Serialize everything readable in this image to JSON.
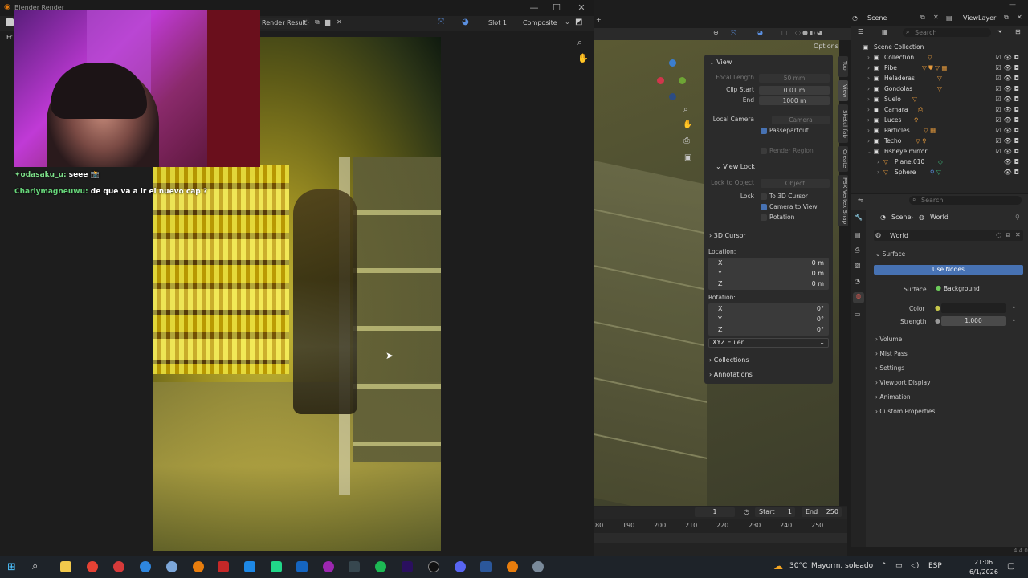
{
  "render_window": {
    "title": "Blender Render",
    "image_name": "Render Result",
    "slot": "Slot 1",
    "pass": "Composite",
    "menu_clip": "Fr"
  },
  "chat": [
    {
      "user": "odasaku_u:",
      "message": "seee 📸"
    },
    {
      "user": "Charlymagneuwu:",
      "message": "de que va a ir el nuevo cap ?"
    }
  ],
  "viewport": {
    "options_label": "Options"
  },
  "npanel": {
    "view_header": "View",
    "focal_length_label": "Focal Length",
    "focal_length_value": "50 mm",
    "clip_start_label": "Clip Start",
    "clip_start_value": "0.01 m",
    "end_label": "End",
    "end_value": "1000 m",
    "local_camera_label": "Local Camera",
    "local_camera_value": "Camera",
    "passepartout_label": "Passepartout",
    "render_region_label": "Render Region",
    "view_lock_header": "View Lock",
    "lock_to_object_label": "Lock to Object",
    "lock_to_object_value": "Object",
    "lock_label": "Lock",
    "to_3d_cursor_label": "To 3D Cursor",
    "camera_to_view_label": "Camera to View",
    "rotation_label": "Rotation",
    "cursor_header": "3D Cursor",
    "location_label": "Location:",
    "x_label": "X",
    "y_label": "Y",
    "z_label": "Z",
    "loc_x": "0 m",
    "loc_y": "0 m",
    "loc_z": "0 m",
    "rotation_section_label": "Rotation:",
    "rot_x": "0°",
    "rot_y": "0°",
    "rot_z": "0°",
    "euler_mode": "XYZ Euler",
    "collections_header": "Collections",
    "annotations_header": "Annotations"
  },
  "sidetabs": [
    "Tool",
    "View",
    "Sketchfab",
    "Create",
    "PSX Vertex Snap"
  ],
  "timeline": {
    "current_frame": "1",
    "start_label": "Start",
    "start_value": "1",
    "end_label": "End",
    "end_value": "250",
    "ticks": [
      "80",
      "190",
      "200",
      "210",
      "220",
      "230",
      "240",
      "250"
    ]
  },
  "outliner": {
    "scene_label": "Scene",
    "viewlayer_label": "ViewLayer",
    "search_placeholder": "Search",
    "root": "Scene Collection",
    "items": [
      {
        "name": "Collection"
      },
      {
        "name": "Pibe"
      },
      {
        "name": "Heladeras"
      },
      {
        "name": "Gondolas"
      },
      {
        "name": "Suelo"
      },
      {
        "name": "Camara"
      },
      {
        "name": "Luces"
      },
      {
        "name": "Particles"
      },
      {
        "name": "Techo"
      },
      {
        "name": "Fisheye mirror"
      },
      {
        "name": "Plane.010"
      },
      {
        "name": "Sphere"
      }
    ]
  },
  "properties": {
    "search_placeholder": "Search",
    "breadcrumb_scene": "Scene",
    "breadcrumb_world": "World",
    "world_name": "World",
    "surface_header": "Surface",
    "use_nodes_label": "Use Nodes",
    "surface_label": "Surface",
    "surface_value": "Background",
    "color_label": "Color",
    "strength_label": "Strength",
    "strength_value": "1.000",
    "panels": [
      "Volume",
      "Mist Pass",
      "Settings",
      "Viewport Display",
      "Animation",
      "Custom Properties"
    ],
    "version": "4.4.0"
  },
  "taskbar": {
    "weather_temp": "30°C",
    "weather_text": "Mayorm. soleado",
    "language": "ESP",
    "time": "21:06",
    "date": "6/1/2026"
  }
}
